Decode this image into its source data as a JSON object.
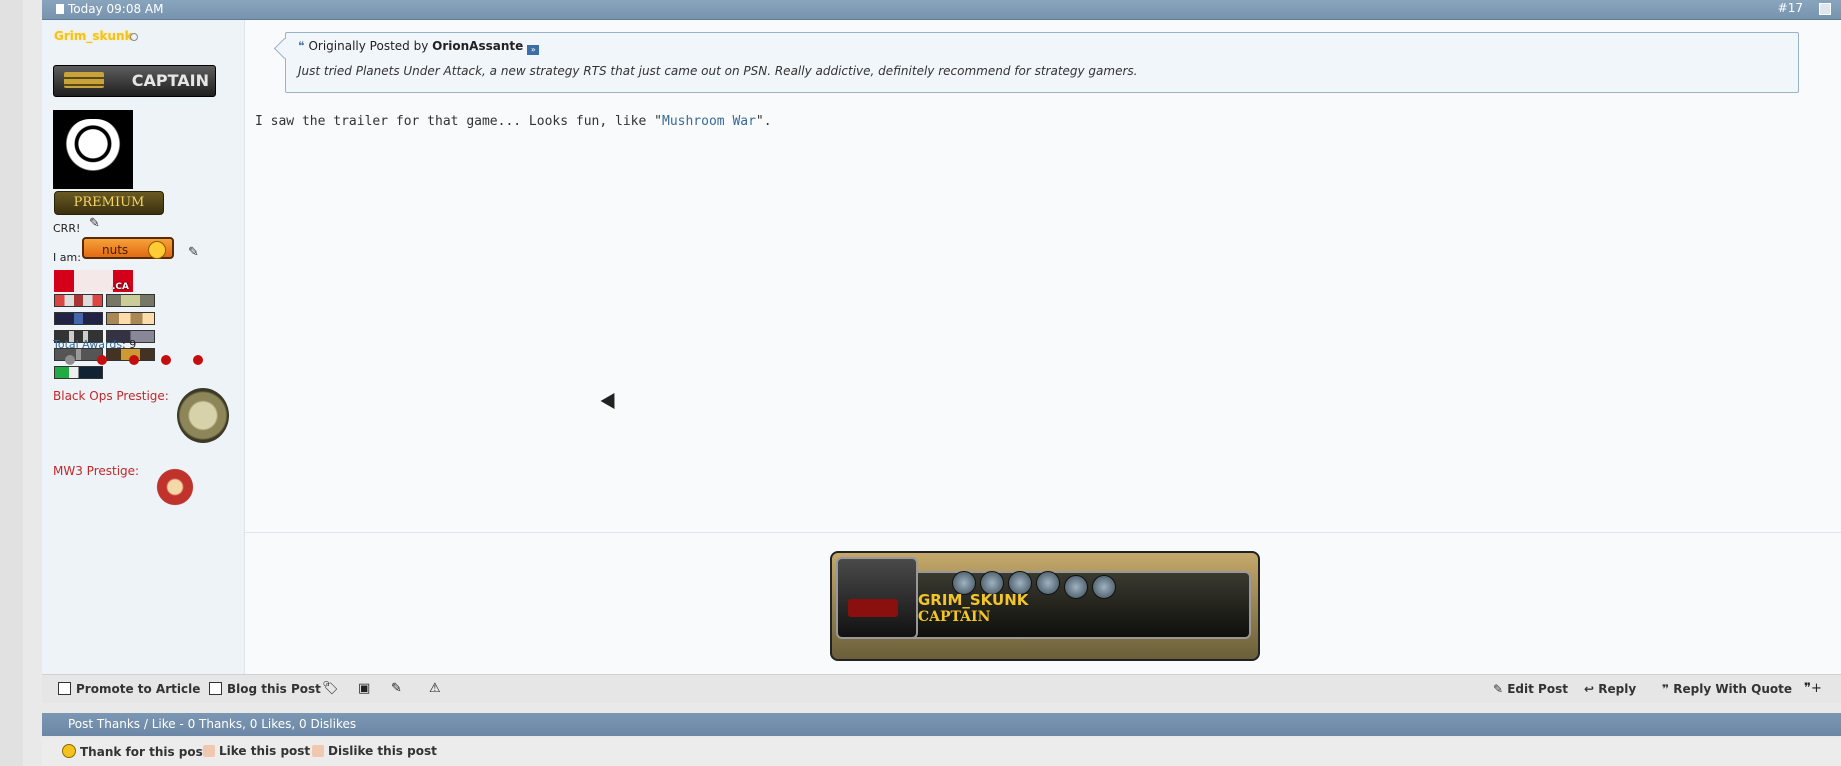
{
  "header": {
    "timestamp": "Today 09:08 AM",
    "post_number": "#17"
  },
  "user": {
    "username": "Grim_skunk",
    "rank_badge": "CAPTAIN",
    "premium_badge": "PREMIUM",
    "title_text": "CRR!",
    "mood_label": "I am:",
    "mood_value": "nuts",
    "country_code": ".CA",
    "total_awards_label": "Total Awards",
    "total_awards_value": ": 9",
    "black_ops_label": "Black Ops Prestige:",
    "mw3_label": "MW3 Prestige:"
  },
  "quote": {
    "prefix": "Originally Posted by",
    "author": "OrionAssante",
    "text": "Just tried Planets Under Attack, a new strategy RTS that just came out on PSN. Really addictive, definitely recommend for strategy gamers."
  },
  "message": {
    "before": "I saw the trailer for that game... Looks fun, like \"",
    "link": "Mushroom War",
    "after": "\"."
  },
  "signature": {
    "name": "GRIM_SKUNK",
    "rank": "CAPTAIN"
  },
  "toolbar": {
    "promote": "Promote to Article",
    "blog": "Blog this Post",
    "edit": "Edit Post",
    "reply": "Reply",
    "reply_quote": "Reply With Quote"
  },
  "thanks": {
    "summary": "Post Thanks / Like - 0 Thanks, 0 Likes, 0 Dislikes",
    "thank": "Thank for this post",
    "like": "Like this post",
    "dislike": "Dislike this post"
  },
  "colors": {
    "accent": "#7793ae",
    "link": "#3b6a96",
    "prestige_label": "#c0282a",
    "username": "#f4c21e"
  }
}
